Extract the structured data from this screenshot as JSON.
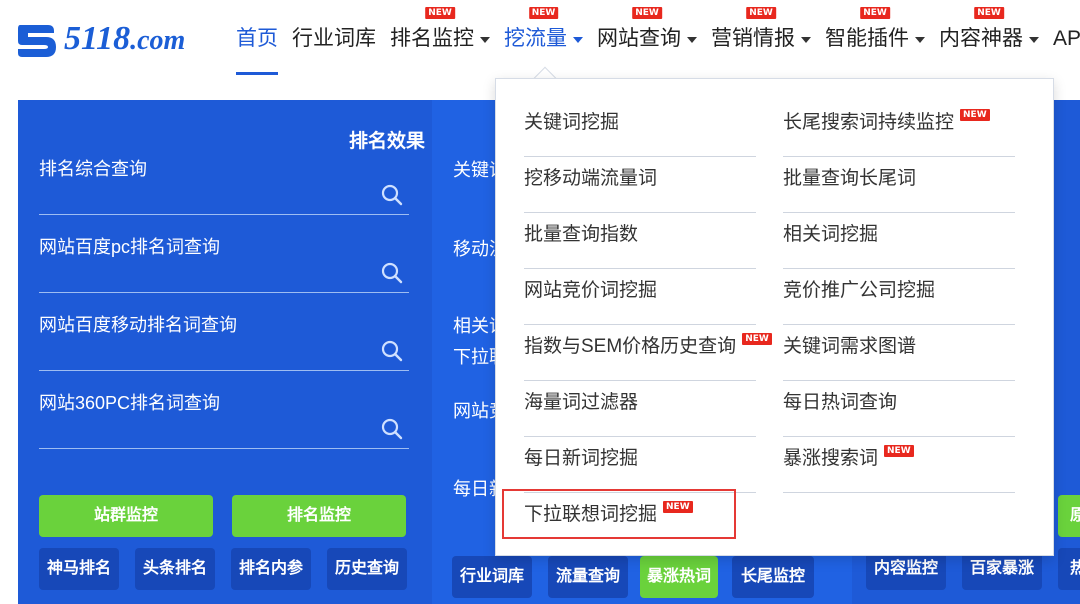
{
  "logo": {
    "number": "5118",
    "suffix": ".com"
  },
  "nav": {
    "items": [
      {
        "label": "首页",
        "state": "active"
      },
      {
        "label": "行业词库"
      },
      {
        "label": "排名监控",
        "new": "NEW",
        "dropdown": true
      },
      {
        "label": "挖流量",
        "new": "NEW",
        "dropdown": true,
        "state": "open"
      },
      {
        "label": "网站查询",
        "new": "NEW",
        "dropdown": true
      },
      {
        "label": "营销情报",
        "new": "NEW",
        "dropdown": true
      },
      {
        "label": "智能插件",
        "new": "NEW",
        "dropdown": true
      },
      {
        "label": "内容神器",
        "new": "NEW",
        "dropdown": true
      },
      {
        "label": "API"
      }
    ]
  },
  "left_panel": {
    "title": "排名效果",
    "queries": [
      "排名综合查询",
      "网站百度pc排名词查询",
      "网站百度移动排名词查询",
      "网站360PC排名词查询"
    ],
    "green_buttons": [
      "站群监控",
      "排名监控"
    ],
    "dark_buttons": [
      "神马排名",
      "头条排名",
      "排名内参",
      "历史查询"
    ]
  },
  "mid_panel": {
    "labels": [
      "关键词",
      "移动流",
      "相关词",
      "下拉联",
      "网站竞",
      "每日新"
    ],
    "buttons": [
      "行业词库",
      "流量查询",
      "暴涨热词",
      "长尾监控"
    ]
  },
  "right_panel": {
    "buttons": [
      "内容监控",
      "百家暴涨",
      "热"
    ],
    "green_fragment": "原"
  },
  "dropdown": {
    "new_tag": "NEW",
    "left_col": [
      {
        "label": "关键词挖掘"
      },
      {
        "label": "挖移动端流量词"
      },
      {
        "label": "批量查询指数"
      },
      {
        "label": "网站竞价词挖掘"
      },
      {
        "label": "指数与SEM价格历史查询",
        "new": true
      },
      {
        "label": "海量词过滤器"
      },
      {
        "label": "每日新词挖掘"
      },
      {
        "label": "下拉联想词挖掘",
        "new": true,
        "highlighted": true
      }
    ],
    "right_col": [
      {
        "label": "长尾搜索词持续监控",
        "new": true
      },
      {
        "label": "批量查询长尾词"
      },
      {
        "label": "相关词挖掘"
      },
      {
        "label": "竞价推广公司挖掘"
      },
      {
        "label": "关键词需求图谱"
      },
      {
        "label": "每日热词查询"
      },
      {
        "label": "暴涨搜索词",
        "new": true
      }
    ]
  },
  "colors": {
    "brand_blue": "#1e5ad7",
    "green": "#6ad23c",
    "new_red": "#e8281e",
    "highlight_red": "#e53935"
  },
  "icons": [
    "logo-mark-icon",
    "search-icon",
    "caret-down-icon"
  ]
}
